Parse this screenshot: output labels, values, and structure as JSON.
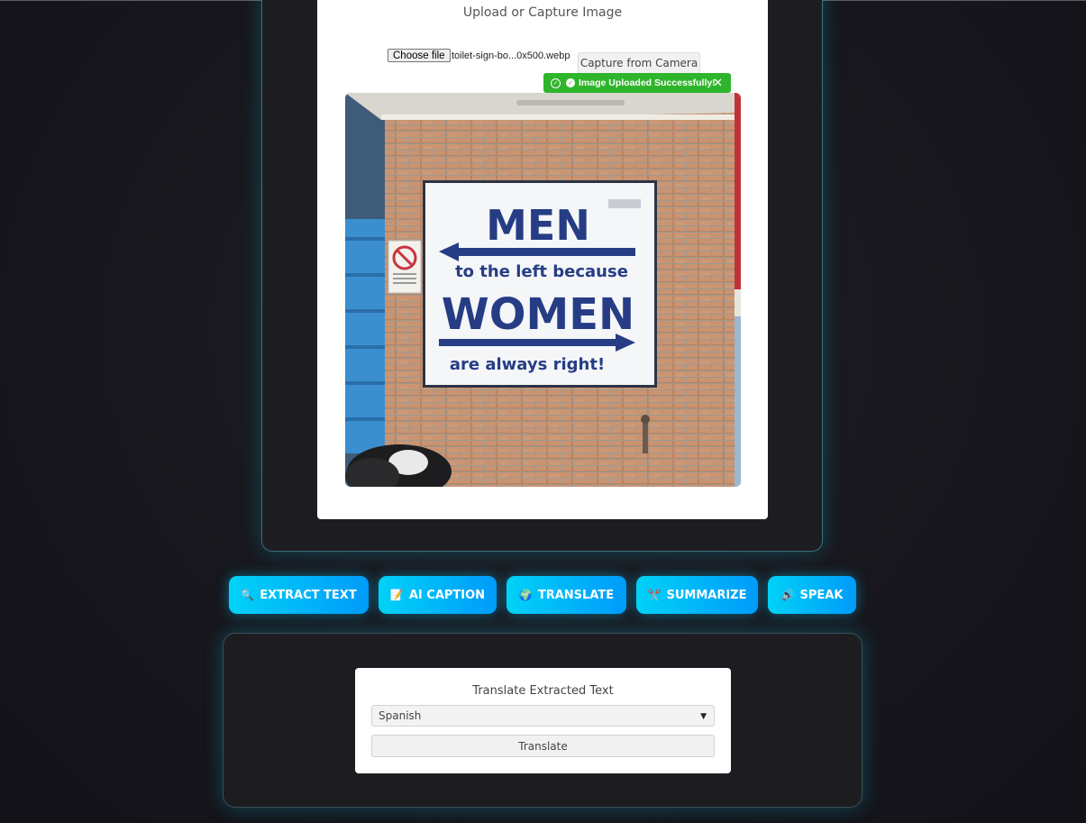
{
  "upload": {
    "title": "Upload or Capture Image",
    "choose_file_label": "Choose file",
    "file_name": "toilet-sign-bo...0x500.webp",
    "camera_label": "Capture from Camera",
    "toast_message": "Image Uploaded Successfully!",
    "toast_close": "✕"
  },
  "photo": {
    "sign_line1": "MEN",
    "sign_line2": "to the left because",
    "sign_line3": "WOMEN",
    "sign_line4": "are always right!"
  },
  "actions": [
    {
      "icon": "🔍",
      "label": "EXTRACT TEXT"
    },
    {
      "icon": "📝",
      "label": "AI CAPTION"
    },
    {
      "icon": "🌍",
      "label": "TRANSLATE"
    },
    {
      "icon": "✂️",
      "label": "SUMMARIZE"
    },
    {
      "icon": "🔊",
      "label": "SPEAK"
    }
  ],
  "translate": {
    "title": "Translate Extracted Text",
    "selected_language": "Spanish",
    "button_label": "Translate"
  },
  "colors": {
    "accent_start": "#00d2f7",
    "accent_end": "#009bfa",
    "success": "#2fb52b",
    "panel_bg": "#1d1d21"
  }
}
